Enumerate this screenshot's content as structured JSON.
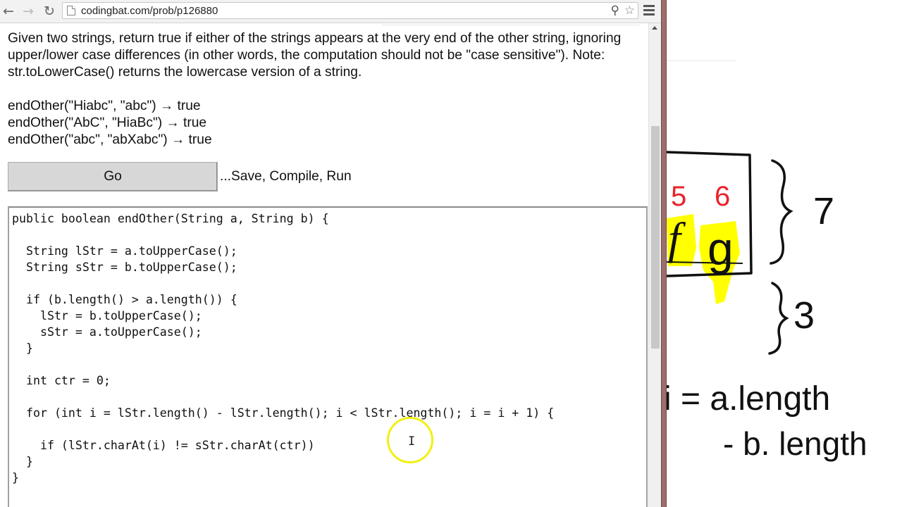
{
  "browser": {
    "url": "codingbat.com/prob/p126880"
  },
  "problem": {
    "description": "Given two strings, return true if either of the strings appears at the very end of the other string, ignoring upper/lower case differences (in other words, the computation should not be \"case sensitive\"). Note: str.toLowerCase() returns the lowercase version of a string.",
    "examples": [
      "endOther(\"Hiabc\", \"abc\") → true",
      "endOther(\"AbC\", \"HiaBc\") → true",
      "endOther(\"abc\", \"abXabc\") → true"
    ],
    "go_label": "Go",
    "go_hint": "...Save, Compile, Run"
  },
  "editor": {
    "code": "public boolean endOther(String a, String b) {\n\n  String lStr = a.toUpperCase();\n  String sStr = b.toUpperCase();\n\n  if (b.length() > a.length()) {\n    lStr = b.toUpperCase();\n    sStr = a.toUpperCase();\n  }\n\n  int ctr = 0;\n\n  for (int i = lStr.length() - lStr.length(); i < lStr.length(); i = i + 1) {\n\n    if (lStr.charAt(i) != sStr.charAt(ctr))\n  }\n}"
  },
  "whiteboard": {
    "index_5": "5",
    "index_6": "6",
    "letter_f": "f",
    "letter_g": "g",
    "brace_label_7": "7",
    "brace_label_3": "3",
    "formula_line1": "i = a.length",
    "formula_line2": "- b. length"
  },
  "colors": {
    "highlight_yellow": "#ffff00",
    "ink_red": "#e8232a",
    "ink_black": "#111111",
    "cursor_ring": "#f2f011",
    "divider": "#9d6f6a"
  }
}
